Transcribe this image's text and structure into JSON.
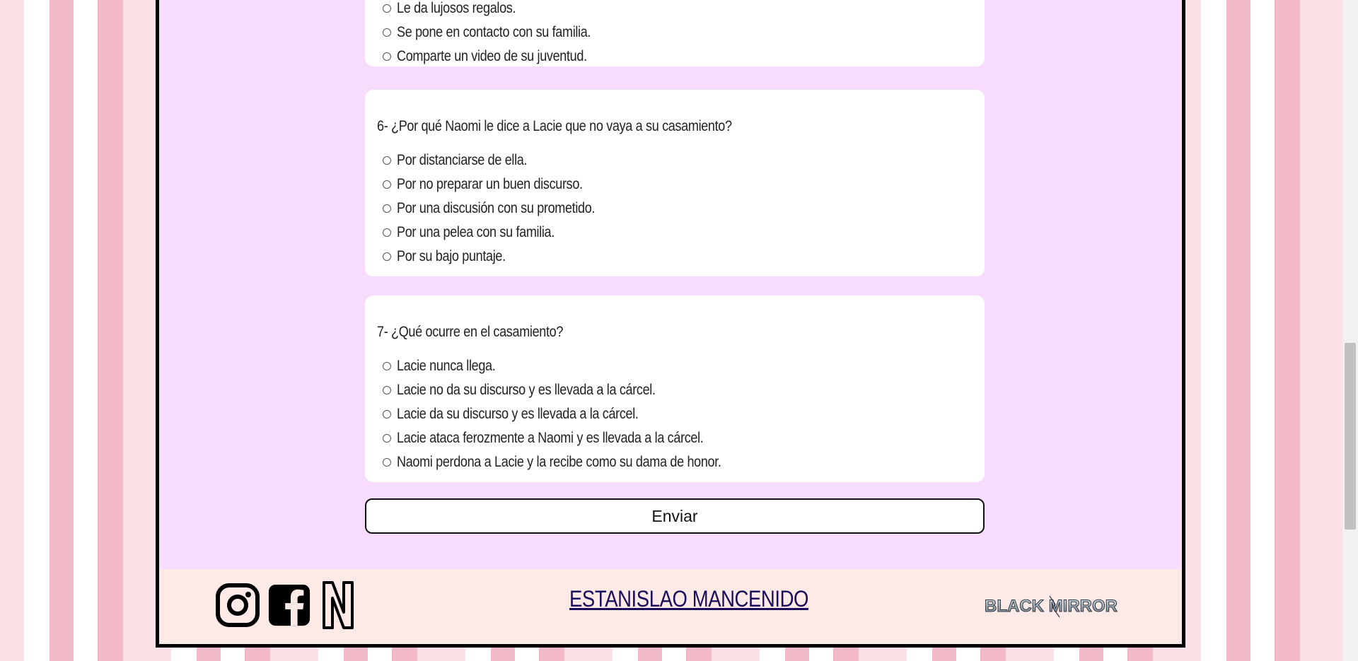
{
  "questions": [
    {
      "title": "",
      "options": [
        "Le da lujosos regalos.",
        "Se pone en contacto con su familia.",
        "Comparte un video de su juventud."
      ]
    },
    {
      "title": "6- ¿Por qué Naomi le dice a Lacie que no vaya a su casamiento?",
      "options": [
        "Por distanciarse de ella.",
        "Por no preparar un buen discurso.",
        "Por una discusión con su prometido.",
        "Por una pelea con su familia.",
        "Por su bajo puntaje."
      ]
    },
    {
      "title": "7- ¿Qué ocurre en el casamiento?",
      "options": [
        "Lacie nunca llega.",
        "Lacie no da su discurso y es llevada a la cárcel.",
        "Lacie da su discurso y es llevada a la cárcel.",
        "Lacie ataca ferozmente a Naomi y es llevada a la cárcel.",
        "Naomi perdona a Lacie y la recibe como su dama de honor."
      ]
    }
  ],
  "submit_label": "Enviar",
  "footer": {
    "author": "ESTANISLAO MANCENIDO",
    "logo_text": "BLACK MIRROR",
    "icons": [
      "instagram-icon",
      "facebook-icon",
      "netflix-icon"
    ]
  },
  "colors": {
    "panel": "#f8dcfd",
    "footer": "#fde9e5",
    "stripe_pink": "#f2b9c9",
    "stripe_light": "#fbe0e6"
  }
}
